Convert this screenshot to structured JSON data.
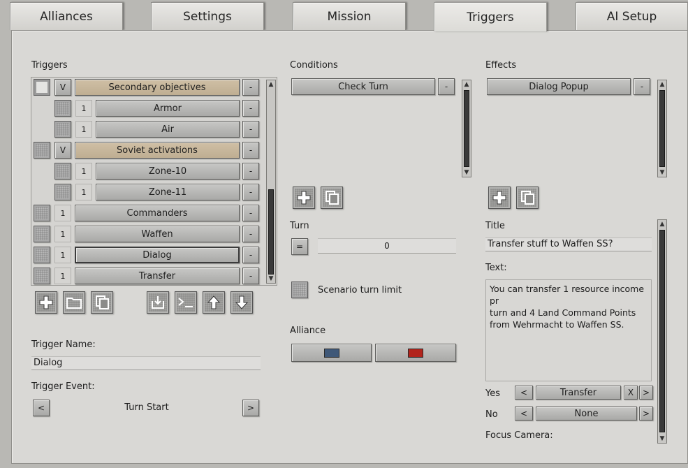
{
  "tabs": [
    {
      "label": "Alliances"
    },
    {
      "label": "Settings"
    },
    {
      "label": "Mission"
    },
    {
      "label": "Triggers"
    },
    {
      "label": "AI Setup"
    }
  ],
  "triggers": {
    "heading": "Triggers",
    "items": [
      {
        "toggle": "V",
        "label": "Secondary objectives",
        "remove": "-"
      },
      {
        "toggle": "1",
        "label": "Armor",
        "remove": "-"
      },
      {
        "toggle": "1",
        "label": "Air",
        "remove": "-"
      },
      {
        "toggle": "V",
        "label": "Soviet activations",
        "remove": "-"
      },
      {
        "toggle": "1",
        "label": "Zone-10",
        "remove": "-"
      },
      {
        "toggle": "1",
        "label": "Zone-11",
        "remove": "-"
      },
      {
        "toggle": "1",
        "label": "Commanders",
        "remove": "-"
      },
      {
        "toggle": "1",
        "label": "Waffen",
        "remove": "-"
      },
      {
        "toggle": "1",
        "label": "Dialog",
        "remove": "-"
      },
      {
        "toggle": "1",
        "label": "Transfer",
        "remove": "-"
      }
    ],
    "name_label": "Trigger Name:",
    "name_value": "Dialog",
    "event_label": "Trigger Event:",
    "event_value": "Turn Start",
    "prev": "<",
    "next": ">"
  },
  "conditions": {
    "heading": "Conditions",
    "items": [
      {
        "label": "Check Turn",
        "remove": "-"
      }
    ],
    "turn_label": "Turn",
    "turn_op": "=",
    "turn_value": "0",
    "limit_label": "Scenario turn limit",
    "alliance_label": "Alliance",
    "colors": {
      "allies": "#3f5878",
      "axis": "#b2241c"
    }
  },
  "effects": {
    "heading": "Effects",
    "items": [
      {
        "label": "Dialog Popup",
        "remove": "-"
      }
    ],
    "title_label": "Title",
    "title_value": "Transfer stuff to Waffen SS?",
    "text_label": "Text:",
    "text_value": "You can transfer 1 resource income pr\nturn and 4 Land Command Points\nfrom Wehrmacht to Waffen SS.",
    "yes_label": "Yes",
    "yes_value": "Transfer",
    "yes_clear": "X",
    "no_label": "No",
    "no_value": "None",
    "prev": "<",
    "next": ">",
    "camera_label": "Focus Camera:"
  }
}
